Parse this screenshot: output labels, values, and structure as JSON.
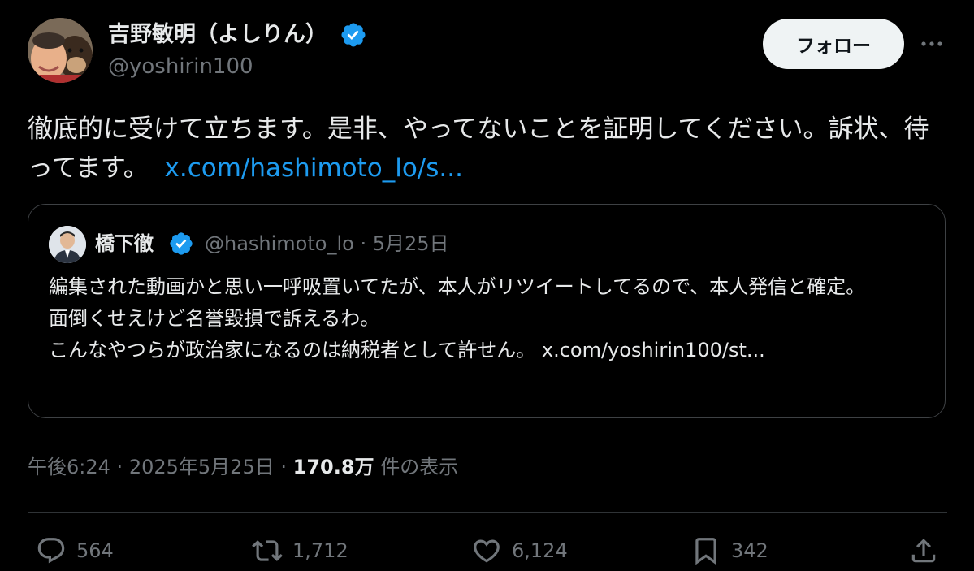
{
  "author": {
    "display_name": "吉野敏明（よしりん）",
    "handle": "@yoshirin100"
  },
  "header": {
    "follow_label": "フォロー",
    "more_icon": "more-horizontal-icon"
  },
  "tweet": {
    "text": "徹底的に受けて立ちます。是非、やってないことを証明してください。訴状、待ってます。",
    "link": "x.com/hashimoto_lo/s..."
  },
  "quote": {
    "name": "橋下徹",
    "handle": "@hashimoto_lo",
    "separator": "·",
    "date": "5月25日",
    "lines": [
      "編集された動画かと思い一呼吸置いてたが、本人がリツイートしてるので、本人発信と確定。",
      "面倒くせえけど名誉毀損で訴えるわ。",
      "こんなやつらが政治家になるのは納税者として許せん。 x.com/yoshirin100/st..."
    ]
  },
  "meta": {
    "time": "午後6:24",
    "sep1": "·",
    "date": "2025年5月25日",
    "sep2": "·",
    "views": "170.8万",
    "views_suffix": "件の表示"
  },
  "actions": {
    "replies": "564",
    "reposts": "1,712",
    "likes": "6,124",
    "bookmarks": "342"
  },
  "colors": {
    "background": "#000000",
    "text": "#e7e9ea",
    "muted": "#71767b",
    "link": "#1d9bf0",
    "verified": "#1d9bf0"
  }
}
